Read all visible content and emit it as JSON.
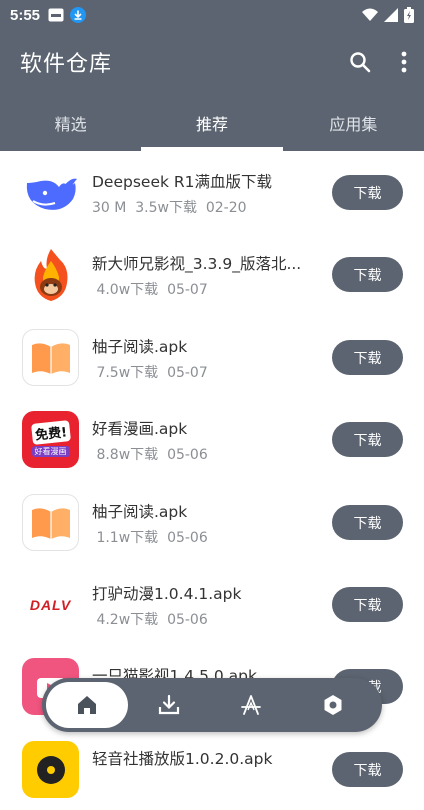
{
  "status_bar": {
    "time": "5:55"
  },
  "app_bar": {
    "title": "软件仓库"
  },
  "tabs": [
    {
      "label": "精选",
      "active": false
    },
    {
      "label": "推荐",
      "active": true
    },
    {
      "label": "应用集",
      "active": false
    }
  ],
  "download_label": "下载",
  "apps": [
    {
      "name": "Deepseek R1满血版下载",
      "meta": "30 M  3.5w下载  02-20",
      "icon": "deepseek-whale-icon"
    },
    {
      "name": "新大师兄影视_3.3.9_版落北...",
      "meta": " 4.0w下载  05-07",
      "icon": "flame-monkey-icon"
    },
    {
      "name": "柚子阅读.apk",
      "meta": " 7.5w下载  05-07",
      "icon": "open-book-icon"
    },
    {
      "name": "好看漫画.apk",
      "meta": " 8.8w下载  05-06",
      "icon": "free-comic-icon",
      "icon_text": "免费!",
      "icon_subtext": "好看漫画"
    },
    {
      "name": "柚子阅读.apk",
      "meta": " 1.1w下载  05-06",
      "icon": "open-book-icon"
    },
    {
      "name": "打驴动漫1.0.4.1.apk",
      "meta": " 4.2w下载  05-06",
      "icon": "dalv-logo-icon",
      "icon_text": "DALV"
    },
    {
      "name": "一只猫影视1.4.5.0.apk",
      "meta": "",
      "icon": "cat-film-icon"
    },
    {
      "name": "轻音社播放版1.0.2.0.apk",
      "meta": "",
      "icon": "music-app-icon"
    }
  ],
  "bottom_nav": [
    {
      "icon": "home-icon",
      "active": true
    },
    {
      "icon": "download-icon",
      "active": false
    },
    {
      "icon": "app-store-icon",
      "active": false
    },
    {
      "icon": "settings-icon",
      "active": false
    }
  ]
}
